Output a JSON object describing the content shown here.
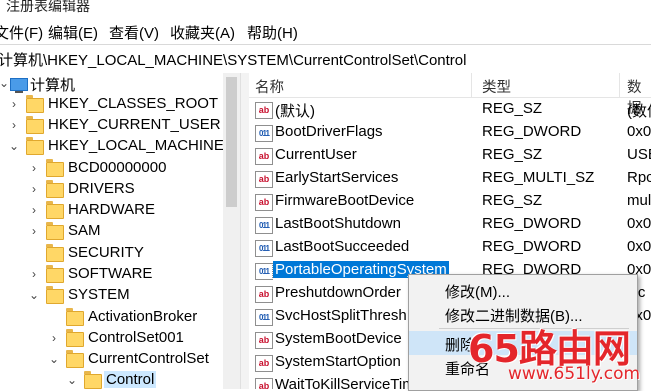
{
  "window": {
    "title": "注册表编辑器"
  },
  "menubar": [
    "文件(F)",
    "编辑(E)",
    "查看(V)",
    "收藏夹(A)",
    "帮助(H)"
  ],
  "address": "计算机\\HKEY_LOCAL_MACHINE\\SYSTEM\\CurrentControlSet\\Control",
  "tree": [
    {
      "label": "计算机",
      "chev": "⌄"
    },
    {
      "label": "HKEY_CLASSES_ROOT",
      "chev": "›"
    },
    {
      "label": "HKEY_CURRENT_USER",
      "chev": "›"
    },
    {
      "label": "HKEY_LOCAL_MACHINE",
      "chev": "⌄"
    },
    {
      "label": "BCD00000000",
      "chev": "›"
    },
    {
      "label": "DRIVERS",
      "chev": "›"
    },
    {
      "label": "HARDWARE",
      "chev": "›"
    },
    {
      "label": "SAM",
      "chev": "›"
    },
    {
      "label": "SECURITY",
      "chev": ""
    },
    {
      "label": "SOFTWARE",
      "chev": "›"
    },
    {
      "label": "SYSTEM",
      "chev": "⌄"
    },
    {
      "label": "ActivationBroker",
      "chev": ""
    },
    {
      "label": "ControlSet001",
      "chev": "›"
    },
    {
      "label": "CurrentControlSet",
      "chev": "⌄"
    },
    {
      "label": "Control",
      "chev": "⌄"
    }
  ],
  "columns": {
    "name": "名称",
    "type": "类型",
    "data": "数据"
  },
  "values": [
    {
      "icon": "ab",
      "name": "(默认)",
      "type": "REG_SZ",
      "data": "(数值"
    },
    {
      "icon": "bin",
      "name": "BootDriverFlags",
      "type": "REG_DWORD",
      "data": "0x0"
    },
    {
      "icon": "ab",
      "name": "CurrentUser",
      "type": "REG_SZ",
      "data": "USE"
    },
    {
      "icon": "ab",
      "name": "EarlyStartServices",
      "type": "REG_MULTI_SZ",
      "data": "Rpc"
    },
    {
      "icon": "ab",
      "name": "FirmwareBootDevice",
      "type": "REG_SZ",
      "data": "mul"
    },
    {
      "icon": "bin",
      "name": "LastBootShutdown",
      "type": "REG_DWORD",
      "data": "0x0"
    },
    {
      "icon": "bin",
      "name": "LastBootSucceeded",
      "type": "REG_DWORD",
      "data": "0x0"
    },
    {
      "icon": "bin",
      "name": "PortableOperatingSystem",
      "type": "REG_DWORD",
      "data": "0x0"
    },
    {
      "icon": "ab",
      "name": "PreshutdownOrder",
      "type": "",
      "data": "lsc"
    },
    {
      "icon": "bin",
      "name": "SvcHostSplitThresh",
      "type": "",
      "data": "0x0"
    },
    {
      "icon": "ab",
      "name": "SystemBootDevice",
      "type": "",
      "data": ""
    },
    {
      "icon": "ab",
      "name": "SystemStartOption",
      "type": "",
      "data": ""
    },
    {
      "icon": "ab",
      "name": "WaitToKillServiceTimeout",
      "type": "",
      "data": ""
    }
  ],
  "context_menu": [
    "修改(M)...",
    "修改二进制数据(B)...",
    "删除",
    "重命名"
  ],
  "watermark": {
    "brand": "65路由网",
    "url": "www.651ly.com"
  }
}
